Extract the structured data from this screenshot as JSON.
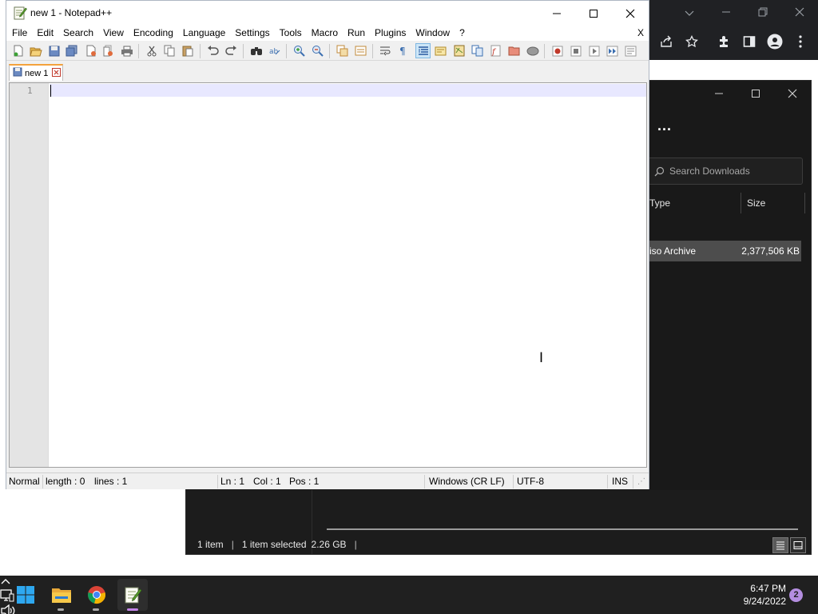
{
  "notepadpp": {
    "title": "new 1 - Notepad++",
    "menu": [
      "File",
      "Edit",
      "Search",
      "View",
      "Encoding",
      "Language",
      "Settings",
      "Tools",
      "Macro",
      "Run",
      "Plugins",
      "Window",
      "?"
    ],
    "menu_close": "X",
    "tab": {
      "label": "new 1"
    },
    "editor": {
      "line_numbers": [
        "1"
      ],
      "content": ""
    },
    "status": {
      "mode": "Normal",
      "length": "length : 0",
      "lines": "lines : 1",
      "ln": "Ln : 1",
      "col": "Col : 1",
      "pos": "Pos : 1",
      "eol": "Windows (CR LF)",
      "encoding": "UTF-8",
      "insert_mode": "INS"
    }
  },
  "explorer": {
    "more": "...",
    "search_placeholder": "Search Downloads",
    "columns": {
      "type": "Type",
      "size": "Size"
    },
    "row": {
      "type": "iso Archive",
      "size": "2,377,506 KB"
    },
    "status": {
      "items": "1 item",
      "selected": "1 item selected",
      "size": "2.26 GB"
    }
  },
  "taskbar": {
    "clock_time": "6:47 PM",
    "clock_date": "9/24/2022",
    "notifications": "2"
  },
  "colors": {
    "taskbar_bg": "#202020",
    "explorer_bg": "#191919",
    "tab_accent": "#f4a23c",
    "current_line": "#e8e8ff"
  }
}
